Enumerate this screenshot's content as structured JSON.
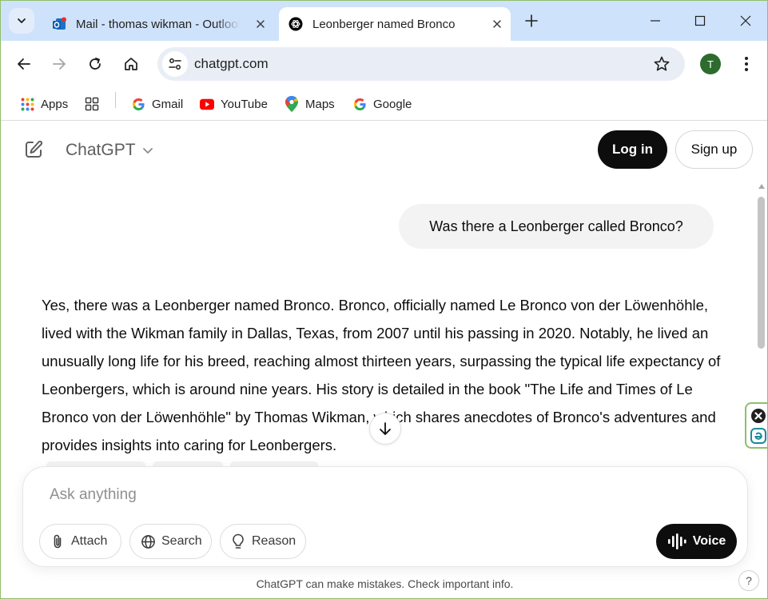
{
  "browser": {
    "tabs": [
      {
        "title": "Mail - thomas wikman - Outlook",
        "favicon": "outlook-icon",
        "active": false
      },
      {
        "title": "Leonberger named Bronco",
        "favicon": "chatgpt-icon",
        "active": true
      }
    ],
    "address": "chatgpt.com",
    "profile_initial": "T",
    "bookmarks": [
      {
        "label": "Apps",
        "icon": "apps-grid-icon"
      },
      {
        "label": "",
        "icon": "tab-groups-icon"
      },
      {
        "label": "Gmail",
        "icon": "google-g-icon"
      },
      {
        "label": "YouTube",
        "icon": "youtube-icon"
      },
      {
        "label": "Maps",
        "icon": "maps-pin-icon"
      },
      {
        "label": "Google",
        "icon": "google-g-icon"
      }
    ]
  },
  "chat": {
    "brand": "ChatGPT",
    "login_label": "Log in",
    "signup_label": "Sign up",
    "user_message": "Was there a Leonberger called Bronco?",
    "answer": "Yes, there was a Leonberger named Bronco. Bronco, officially named Le Bronco von der Löwenhöhle, lived with the Wikman family in Dallas, Texas, from 2007 until his passing in 2020. Notably, he lived an unusually long life for his breed, reaching almost thirteen years, surpassing the typical life expectancy of Leonbergers, which is around nine years. His story is detailed in the book \"The Life and Times of Le Bronco von der Löwenhöhle\" by Thomas Wikman, which shares anecdotes of Bronco's adventures and provides insights into caring for Leonbergers.",
    "composer": {
      "placeholder": "Ask anything",
      "value": "",
      "attach_label": "Attach",
      "search_label": "Search",
      "reason_label": "Reason",
      "voice_label": "Voice"
    },
    "disclaimer": "ChatGPT can make mistakes. Check important info.",
    "help_label": "?"
  },
  "colors": {
    "tabstrip_bg": "#cfe2fb",
    "omnibox_bg": "#e9eef6",
    "window_border": "#8fbf6a",
    "primary_button": "#0d0d0d",
    "user_bubble": "#f3f3f3"
  }
}
